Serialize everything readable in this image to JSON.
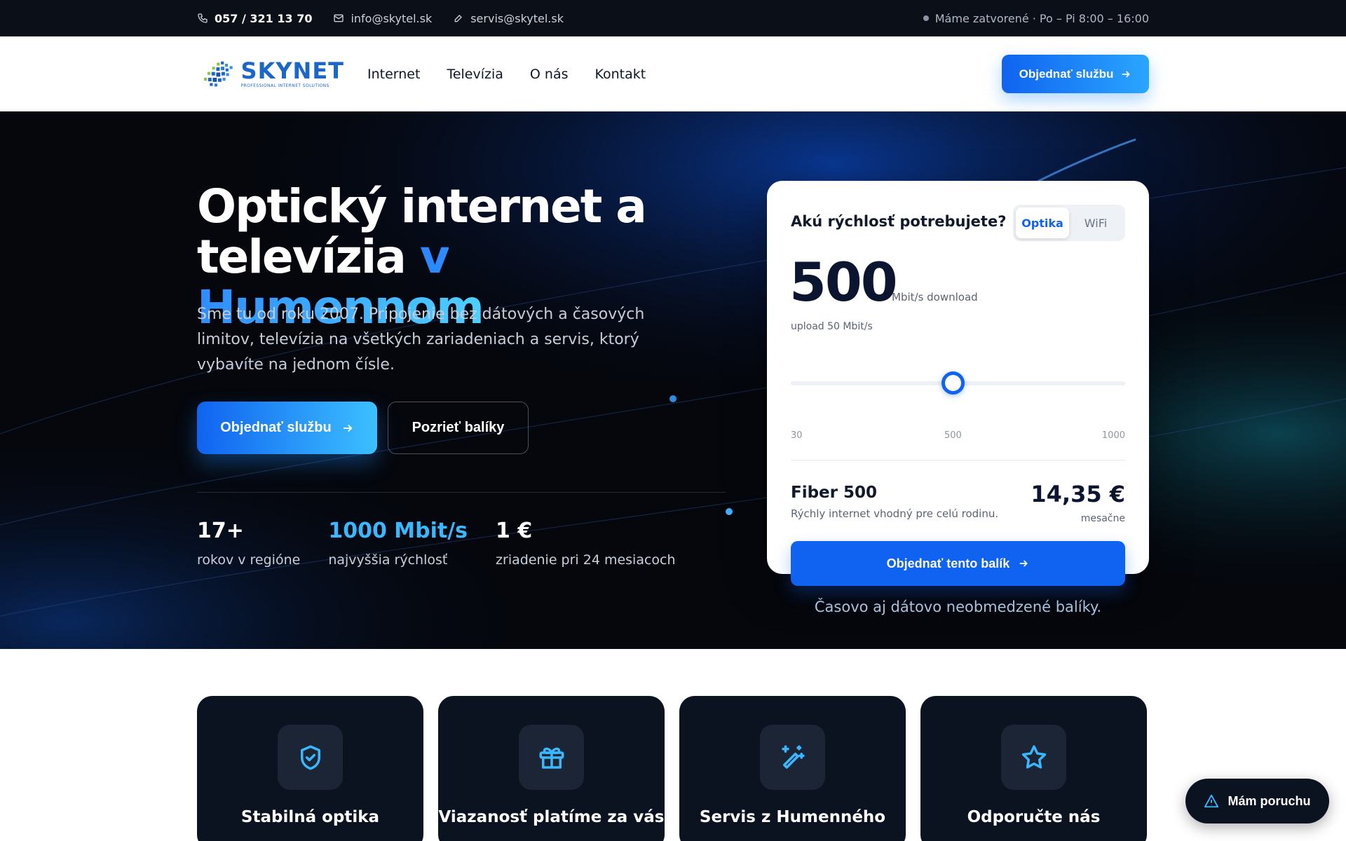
{
  "topbar": {
    "phone": "057 / 321 13 70",
    "email": "info@skytel.sk",
    "service_email": "servis@skytel.sk",
    "status": "Máme zatvorené · Po – Pi 8:00 – 16:00"
  },
  "nav": {
    "logo_name": "SKYNET",
    "logo_sub": "PROFESSIONAL INTERNET SOLUTIONS",
    "items": [
      "Internet",
      "Televízia",
      "O nás",
      "Kontakt"
    ],
    "cta": "Objednať službu"
  },
  "hero": {
    "title_line1": "Optický internet a",
    "title_line2a": "televízia ",
    "title_line2b": "v Humennom",
    "desc": "Sme tu od roku 2007. Pripojenie bez dátových a časových limitov, televízia na všetkých zariadeniach a servis, ktorý vybavíte na jednom čísle.",
    "btn_primary": "Objednať službu",
    "btn_secondary": "Pozrieť balíky",
    "stats": [
      {
        "value": "17+",
        "label": "rokov v regióne"
      },
      {
        "value": "1000 Mbit/s",
        "label": "najvyššia rýchlosť"
      },
      {
        "value": "1 €",
        "label": "zriadenie pri 24 mesiacoch"
      }
    ]
  },
  "speed_card": {
    "question": "Akú rýchlosť potrebujete?",
    "options": [
      "Optika",
      "WiFi"
    ],
    "active_option": "Optika",
    "speed": "500",
    "speed_unit": "Mbit/s download",
    "upload": "upload 50 Mbit/s",
    "slider": {
      "min": 30,
      "max": 1000,
      "value": 500
    },
    "ticks": [
      "30",
      "500",
      "1000"
    ],
    "plan_name": "Fiber 500",
    "plan_desc": "Rýchly internet vhodný pre celú rodinu.",
    "price": "14,35 €",
    "price_period": "mesačne",
    "cta": "Objednať tento balík",
    "note": "Časovo aj dátovo neobmedzené balíky."
  },
  "features": [
    {
      "title": "Stabilná optika",
      "icon": "shield-check-icon"
    },
    {
      "title": "Viazanosť platíme za vás",
      "icon": "gift-icon"
    },
    {
      "title": "Servis z Humenného",
      "icon": "magic-wand-icon"
    },
    {
      "title": "Odporučte nás",
      "icon": "star-icon"
    }
  ],
  "floating": {
    "label": "Mám poruchu"
  },
  "colors": {
    "accent": "#1063f0",
    "accent_light": "#39b8ff",
    "hero_bg": "#05070d",
    "card_dark": "#0b1220"
  }
}
